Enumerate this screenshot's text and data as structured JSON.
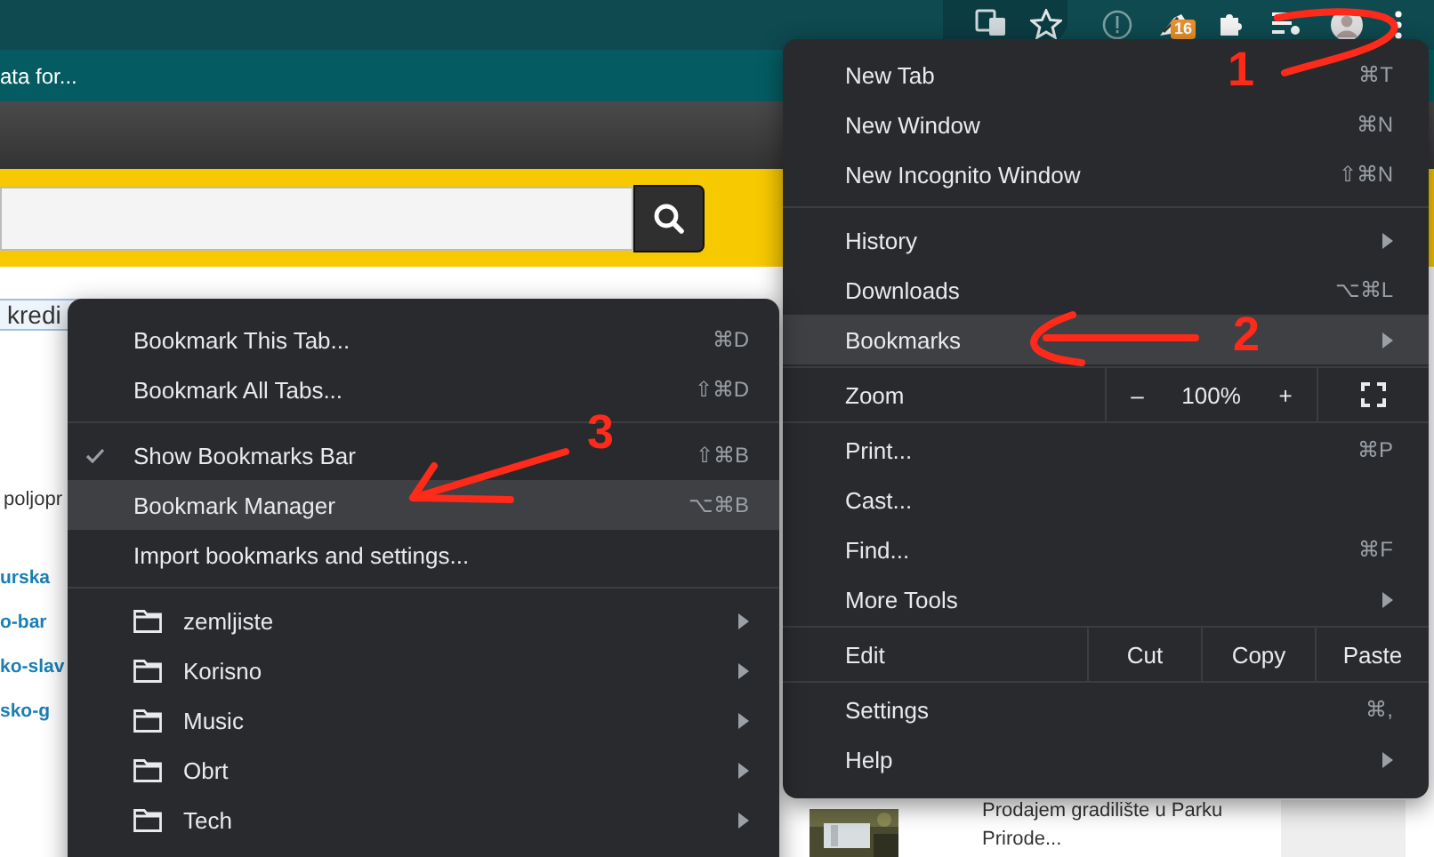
{
  "toolbar": {
    "extension_badge": "16"
  },
  "bookmarks_bar": {
    "text": "ata for..."
  },
  "page": {
    "box_text": "kredi",
    "snippet": "poljopr",
    "links": [
      "urska",
      "o-bar",
      "ko-slav",
      "sko-g"
    ],
    "listing": {
      "title": "Prodajem gradilište u Parku Prirode..."
    }
  },
  "main_menu": {
    "items": [
      {
        "kind": "item",
        "label": "New Tab",
        "shortcut": "⌘T",
        "submenu": false,
        "selected": false
      },
      {
        "kind": "item",
        "label": "New Window",
        "shortcut": "⌘N",
        "submenu": false,
        "selected": false
      },
      {
        "kind": "item",
        "label": "New Incognito Window",
        "shortcut": "⇧⌘N",
        "submenu": false,
        "selected": false
      },
      {
        "kind": "separator"
      },
      {
        "kind": "item",
        "label": "History",
        "submenu": true,
        "selected": false
      },
      {
        "kind": "item",
        "label": "Downloads",
        "shortcut": "⌥⌘L",
        "submenu": false,
        "selected": false
      },
      {
        "kind": "item",
        "label": "Bookmarks",
        "submenu": true,
        "selected": true
      },
      {
        "kind": "zoom",
        "label": "Zoom",
        "minus": "–",
        "value": "100%",
        "plus": "+"
      },
      {
        "kind": "item",
        "label": "Print...",
        "shortcut": "⌘P",
        "submenu": false,
        "selected": false
      },
      {
        "kind": "item",
        "label": "Cast...",
        "submenu": false,
        "selected": false
      },
      {
        "kind": "item",
        "label": "Find...",
        "shortcut": "⌘F",
        "submenu": false,
        "selected": false
      },
      {
        "kind": "item",
        "label": "More Tools",
        "submenu": true,
        "selected": false
      },
      {
        "kind": "edit",
        "label": "Edit",
        "actions": [
          "Cut",
          "Copy",
          "Paste"
        ]
      },
      {
        "kind": "item",
        "label": "Settings",
        "shortcut": "⌘,",
        "submenu": false,
        "selected": false
      },
      {
        "kind": "item",
        "label": "Help",
        "submenu": true,
        "selected": false
      }
    ]
  },
  "bookmarks_menu": {
    "items": [
      {
        "kind": "item",
        "label": "Bookmark This Tab...",
        "shortcut": "⌘D",
        "checked": false,
        "selected": false
      },
      {
        "kind": "item",
        "label": "Bookmark All Tabs...",
        "shortcut": "⇧⌘D",
        "checked": false,
        "selected": false
      },
      {
        "kind": "separator"
      },
      {
        "kind": "item",
        "label": "Show Bookmarks Bar",
        "shortcut": "⇧⌘B",
        "checked": true,
        "selected": false
      },
      {
        "kind": "item",
        "label": "Bookmark Manager",
        "shortcut": "⌥⌘B",
        "checked": false,
        "selected": true
      },
      {
        "kind": "item",
        "label": "Import bookmarks and settings...",
        "checked": false,
        "selected": false
      },
      {
        "kind": "separator"
      },
      {
        "kind": "folder",
        "label": "zemljiste"
      },
      {
        "kind": "folder",
        "label": "Korisno"
      },
      {
        "kind": "folder",
        "label": "Music"
      },
      {
        "kind": "folder",
        "label": "Obrt"
      },
      {
        "kind": "folder",
        "label": "Tech"
      }
    ]
  },
  "annotations": [
    {
      "number": "1"
    },
    {
      "number": "2"
    },
    {
      "number": "3"
    }
  ]
}
